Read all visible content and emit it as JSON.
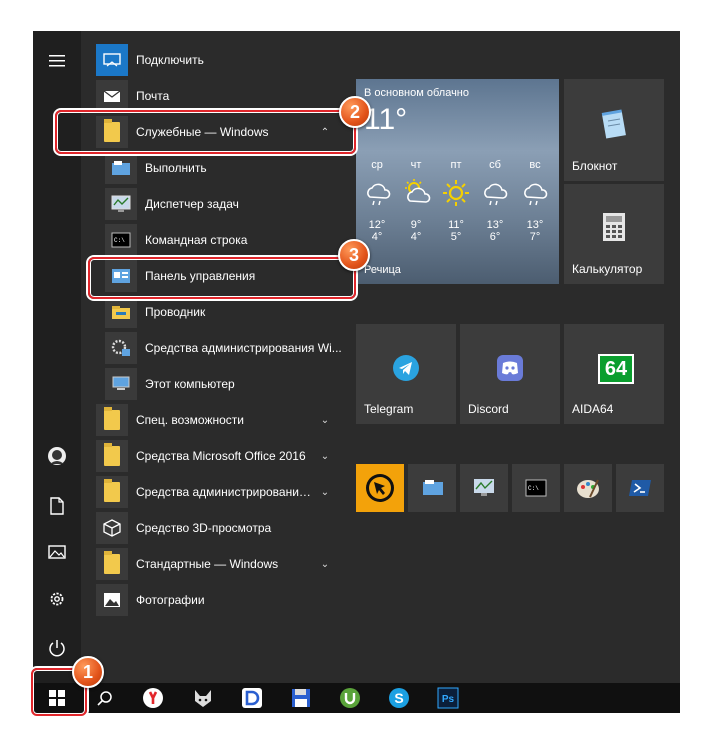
{
  "menu": {
    "items": [
      {
        "label": "Подключить",
        "icon": "connect-icon"
      },
      {
        "label": "Почта",
        "icon": "mail-icon"
      },
      {
        "label": "Служебные — Windows",
        "icon": "folder-icon"
      },
      {
        "label": "Выполнить",
        "icon": "run-icon"
      },
      {
        "label": "Диспетчер задач",
        "icon": "task-manager-icon"
      },
      {
        "label": "Командная строка",
        "icon": "cmd-icon"
      },
      {
        "label": "Панель управления",
        "icon": "control-panel-icon"
      },
      {
        "label": "Проводник",
        "icon": "explorer-icon"
      },
      {
        "label": "Средства администрирования Wi...",
        "icon": "admin-tools-icon"
      },
      {
        "label": "Этот компьютер",
        "icon": "this-pc-icon"
      },
      {
        "label": "Спец. возможности",
        "icon": "folder-icon"
      },
      {
        "label": "Средства Microsoft Office 2016",
        "icon": "folder-icon"
      },
      {
        "label": "Средства администрирования...",
        "icon": "folder-icon"
      },
      {
        "label": "Средство 3D-просмотра",
        "icon": "3d-viewer-icon"
      },
      {
        "label": "Стандартные — Windows",
        "icon": "folder-icon"
      },
      {
        "label": "Фотографии",
        "icon": "photos-icon"
      }
    ]
  },
  "weather": {
    "condition": "В основном облачно",
    "temp": "11°",
    "city": "Речица",
    "days": [
      {
        "day": "ср",
        "hi": "12°",
        "lo": "4°"
      },
      {
        "day": "чт",
        "hi": "9°",
        "lo": "4°"
      },
      {
        "day": "пт",
        "hi": "11°",
        "lo": "5°"
      },
      {
        "day": "сб",
        "hi": "13°",
        "lo": "6°"
      },
      {
        "day": "вс",
        "hi": "13°",
        "lo": "7°"
      }
    ]
  },
  "tiles": {
    "notepad": "Блокнот",
    "calculator": "Калькулятор",
    "telegram": "Telegram",
    "discord": "Discord",
    "aida": "AIDA64",
    "aida_badge": "64"
  },
  "callouts": {
    "one": "1",
    "two": "2",
    "three": "3"
  },
  "colors": {
    "accent": "#1b78c8",
    "callout": "#e0262b",
    "badge": "#e2531a"
  }
}
